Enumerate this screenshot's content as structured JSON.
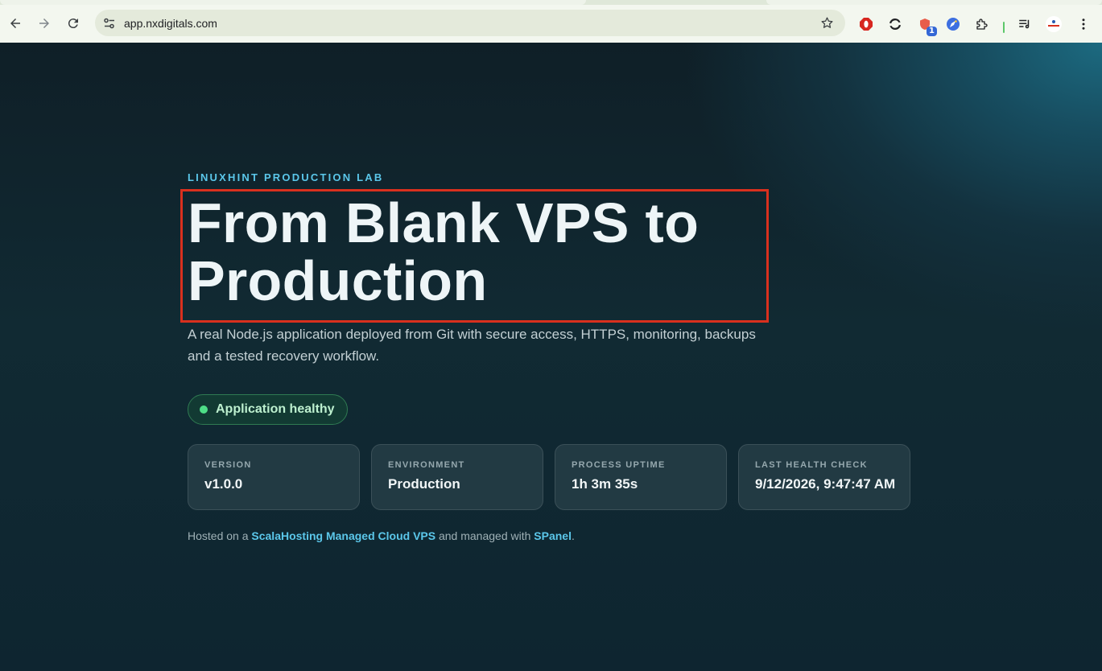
{
  "browser": {
    "url": "app.nxdigitals.com",
    "extension_badge": "1"
  },
  "page": {
    "eyebrow": "LINUXHINT PRODUCTION LAB",
    "headline_line1": "From Blank VPS to",
    "headline_line2": "Production",
    "lead": "A real Node.js application deployed from Git with secure access, HTTPS, monitoring, backups and a tested recovery workflow.",
    "status": "Application healthy",
    "stats": [
      {
        "label": "VERSION",
        "value": "v1.0.0"
      },
      {
        "label": "ENVIRONMENT",
        "value": "Production"
      },
      {
        "label": "PROCESS UPTIME",
        "value": "1h 3m 35s"
      },
      {
        "label": "LAST HEALTH CHECK",
        "value": "9/12/2026, 9:47:47 AM"
      }
    ],
    "footer": {
      "prefix": "Hosted on a ",
      "host_link": "ScalaHosting Managed Cloud VPS",
      "middle": " and managed with ",
      "panel_link": "SPanel",
      "suffix": "."
    }
  },
  "colors": {
    "accent": "#5bc7ea",
    "healthy": "#4ede87",
    "highlight_box": "#d9301e"
  }
}
